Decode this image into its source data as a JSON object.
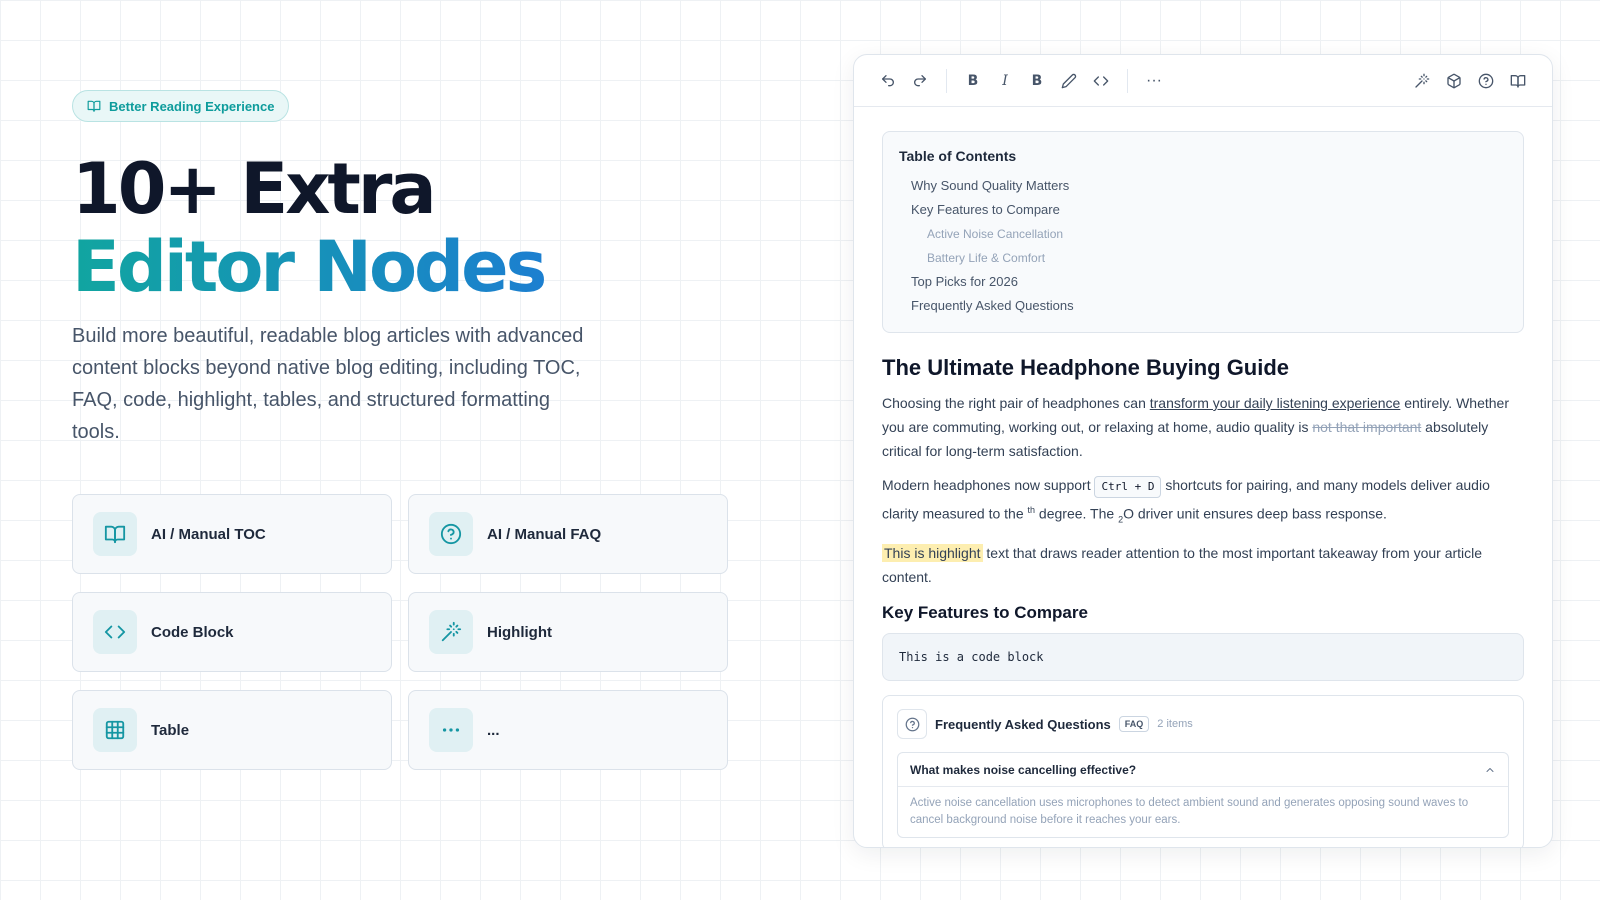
{
  "badge": {
    "label": "Better Reading Experience",
    "icon": "book-open-icon"
  },
  "hero": {
    "line1": "10+ Extra",
    "line2": "Editor Nodes"
  },
  "lead": "Build more beautiful, readable blog articles with advanced content blocks beyond native blog editing, including TOC, FAQ, code, highlight, tables, and structured formatting tools.",
  "features": [
    {
      "label": "AI / Manual TOC",
      "icon": "book-icon"
    },
    {
      "label": "AI / Manual FAQ",
      "icon": "help-circle-icon"
    },
    {
      "label": "Code Block",
      "icon": "code-icon"
    },
    {
      "label": "Highlight",
      "icon": "magic-wand-icon"
    },
    {
      "label": "Table",
      "icon": "table-icon"
    },
    {
      "label": "...",
      "icon": "more-icon"
    }
  ],
  "toolbar": {
    "bold_label": "B",
    "italic_label": "I",
    "bold2_label": "B",
    "more_label": "···"
  },
  "toc": {
    "title": "Table of Contents",
    "items": [
      "Why Sound Quality Matters",
      "Key Features to Compare",
      "Active Noise Cancellation",
      "Battery Life & Comfort",
      "Top Picks for 2026",
      "Frequently Asked Questions"
    ]
  },
  "article": {
    "title": "The Ultimate Headphone Buying Guide",
    "p1_a": "Choosing the right pair of headphones can ",
    "p1_link": "transform your daily listening experience",
    "p1_b": " entirely. Whether you are commuting, working out, or relaxing at home, audio quality is ",
    "p1_strike": "not that important",
    "p1_c": " absolutely critical for long-term satisfaction.",
    "p2_a": "Modern headphones now support ",
    "p2_kbd": "Ctrl + D",
    "p2_b": " shortcuts for pairing, and many models deliver audio clarity measured to the ",
    "p2_sup": "th",
    "p2_c": " degree. The ",
    "p2_sub": "2",
    "p2_d": "O driver unit ensures deep bass response.",
    "p3_hl": "This is highlight",
    "p3_rest": " text that draws reader attention to the most important takeaway from your article content.",
    "h2": "Key Features to Compare",
    "code": "This is a code block"
  },
  "faq": {
    "title": "Frequently Asked Questions",
    "tag": "FAQ",
    "count": "2 items",
    "q1": "What makes noise cancelling effective?",
    "a1": "Active noise cancellation uses microphones to detect ambient sound and generates opposing sound waves to cancel background noise before it reaches your ears."
  }
}
